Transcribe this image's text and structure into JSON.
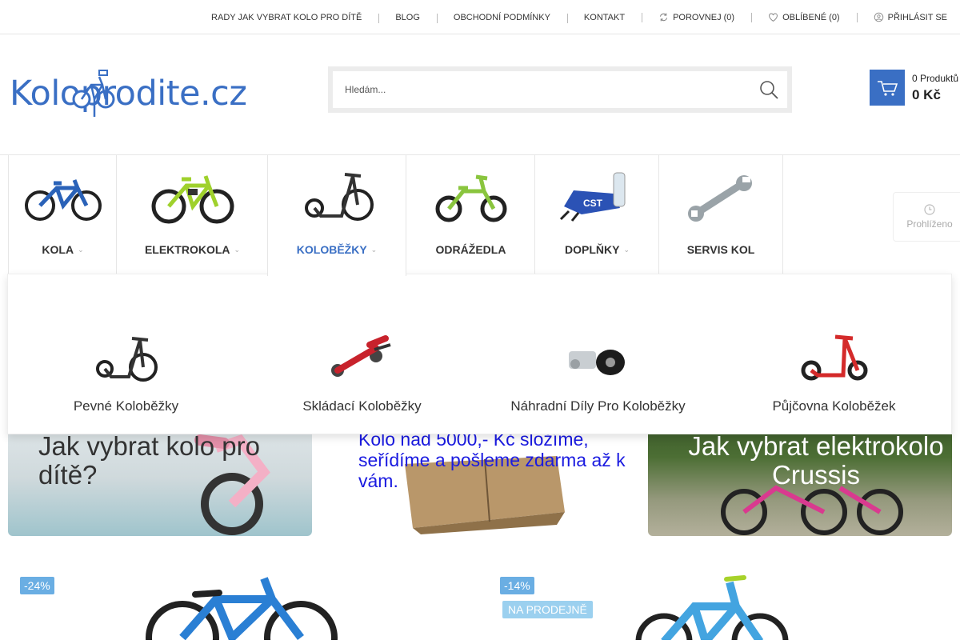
{
  "topbar": {
    "links": [
      {
        "label": "RADY JAK VYBRAT KOLO PRO DÍTĚ"
      },
      {
        "label": "BLOG"
      },
      {
        "label": "OBCHODNÍ PODMÍNKY"
      },
      {
        "label": "KONTAKT"
      },
      {
        "label": "POROVNEJ (0)",
        "icon": "compare-icon"
      },
      {
        "label": "OBLÍBENÉ (0)",
        "icon": "heart-icon"
      },
      {
        "label": "PŘIHLÁSIT SE",
        "icon": "user-icon"
      }
    ]
  },
  "header": {
    "logo_text": "Koloprodite.cz",
    "search_placeholder": "Hledám...",
    "cart_count": "0 Produktů",
    "cart_total": "0 Kč"
  },
  "nav": {
    "items": [
      {
        "label": "KOLA",
        "has_dropdown": true
      },
      {
        "label": "ELEKTROKOLA",
        "has_dropdown": true
      },
      {
        "label": "KOLOBĚŽKY",
        "has_dropdown": true,
        "active": true
      },
      {
        "label": "ODRÁŽEDLA",
        "has_dropdown": false
      },
      {
        "label": "DOPLŇKY",
        "has_dropdown": true
      },
      {
        "label": "SERVIS KOL",
        "has_dropdown": false
      }
    ]
  },
  "history": {
    "label": "Prohlíženo"
  },
  "mega_menu": {
    "items": [
      {
        "label": "Pevné Koloběžky"
      },
      {
        "label": "Skládací Koloběžky"
      },
      {
        "label": "Náhradní Díly Pro Koloběžky"
      },
      {
        "label": "Půjčovna Koloběžek"
      }
    ]
  },
  "banners": [
    {
      "title": "Jak vybrat kolo pro dítě?"
    },
    {
      "title": "Kolo nad 5000,- Kč složíme, seřídíme a pošleme zdarma až k vám."
    },
    {
      "title": "Jak vybrat elektrokolo Crussis"
    }
  ],
  "products": [
    {
      "discount": "-24%"
    },
    {
      "discount": "-14%",
      "tag": "NA PRODEJNĚ"
    }
  ],
  "colors": {
    "brand": "#3a6fc4",
    "badge": "#6aaee3",
    "badge_light": "#9bd0ef"
  }
}
